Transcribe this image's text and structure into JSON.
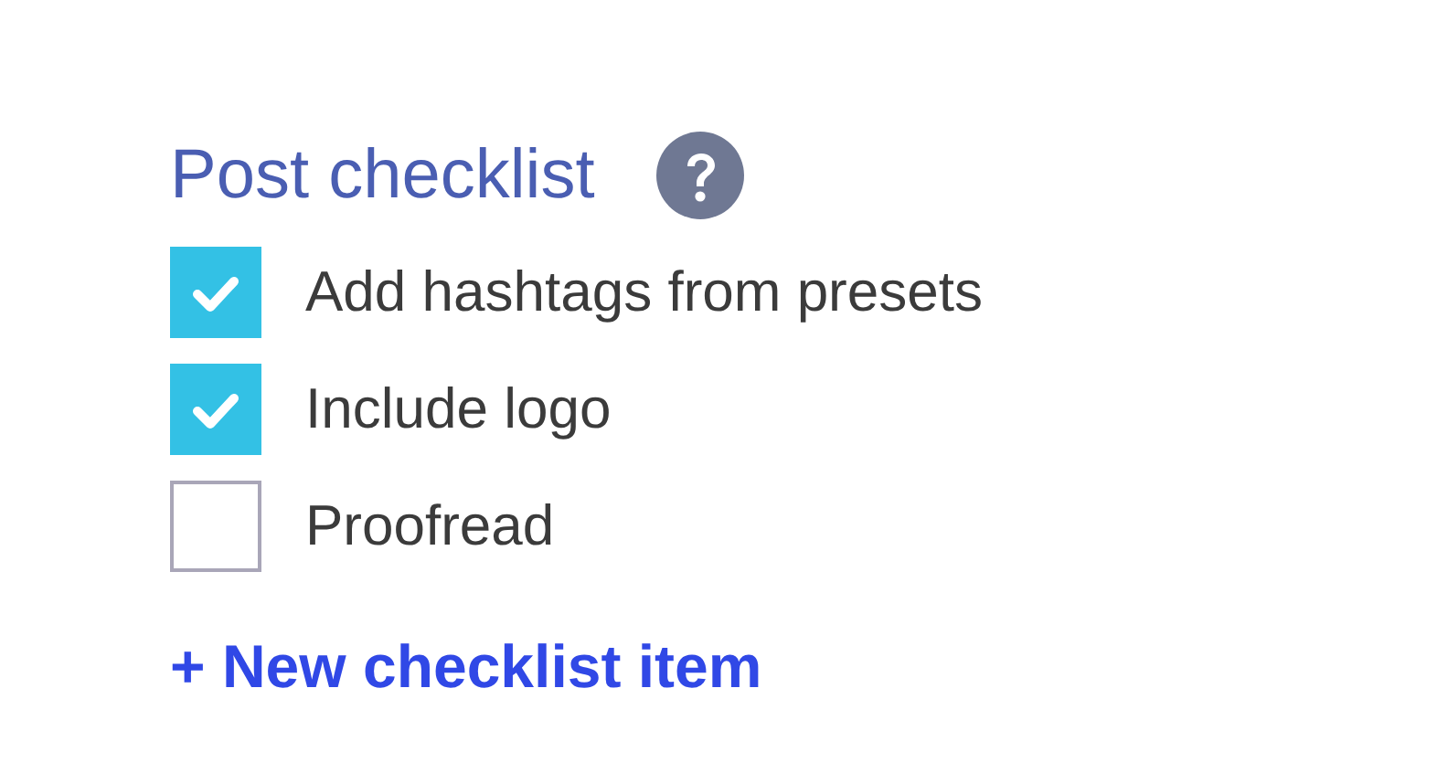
{
  "title": "Post checklist",
  "items": [
    {
      "label": "Add hashtags from presets",
      "checked": true
    },
    {
      "label": "Include logo",
      "checked": true
    },
    {
      "label": "Proofread",
      "checked": false
    }
  ],
  "add_link": "+ New checklist item"
}
